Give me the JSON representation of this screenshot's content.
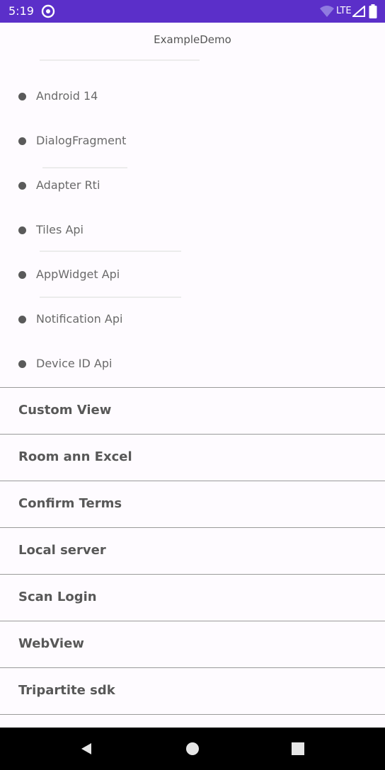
{
  "status_bar": {
    "time": "5:19",
    "network": "LTE",
    "icons": [
      "sync-icon",
      "wifi-icon",
      "signal-icon",
      "battery-icon"
    ]
  },
  "app_bar": {
    "title": "ExampleDemo"
  },
  "sub_list": {
    "items": [
      {
        "label": "Android 14"
      },
      {
        "label": "DialogFragment"
      },
      {
        "label": "Adapter Rti"
      },
      {
        "label": "Tiles Api"
      },
      {
        "label": "AppWidget Api"
      },
      {
        "label": "Notification Api"
      },
      {
        "label": "Device ID Api"
      }
    ]
  },
  "main_list": {
    "items": [
      {
        "label": "Custom View"
      },
      {
        "label": "Room ann Excel"
      },
      {
        "label": "Confirm Terms"
      },
      {
        "label": "Local server"
      },
      {
        "label": "Scan Login"
      },
      {
        "label": "WebView"
      },
      {
        "label": "Tripartite sdk"
      }
    ]
  },
  "nav_bar": {
    "buttons": [
      "back-icon",
      "home-icon",
      "recents-icon"
    ]
  },
  "colors": {
    "status_bar": "#5b2fc9",
    "background": "#fefbff",
    "nav_bar": "#000000",
    "divider": "#9a9a9a"
  }
}
